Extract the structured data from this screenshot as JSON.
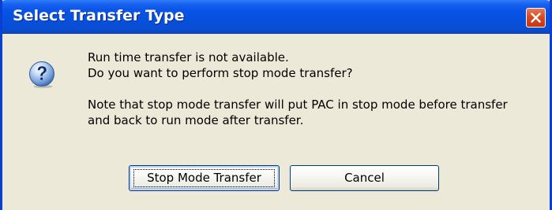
{
  "window": {
    "title": "Select Transfer Type"
  },
  "icons": {
    "dialog": "question-icon",
    "close": "close-icon"
  },
  "message": {
    "line1": "Run time transfer is not available.",
    "line2": "Do you want to perform stop mode transfer?",
    "line3": "Note that stop mode transfer will put PAC in stop mode before transfer",
    "line4": "and back to run mode after transfer."
  },
  "buttons": {
    "stop_mode_transfer": "Stop Mode Transfer",
    "cancel": "Cancel"
  },
  "colors": {
    "titlebar": "#0550dd",
    "dialog_bg": "#ece9d8",
    "close_button": "#d84a22"
  }
}
